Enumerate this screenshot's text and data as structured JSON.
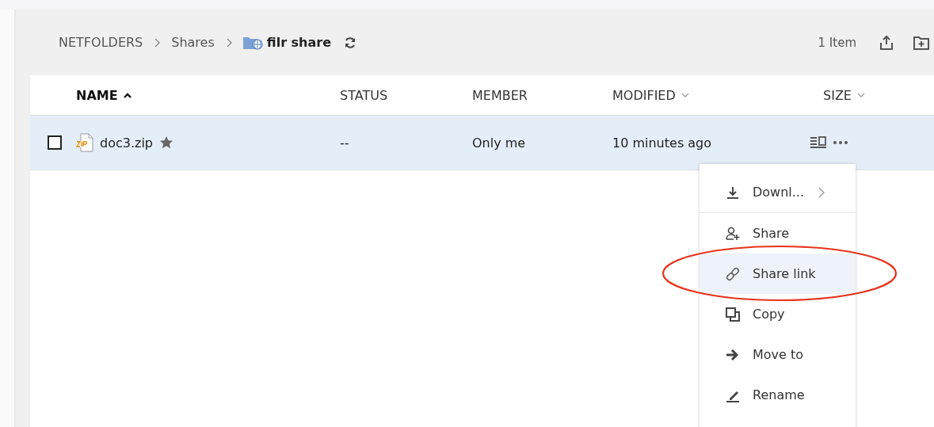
{
  "breadcrumb": [
    {
      "label": "NETFOLDERS",
      "kind": "link"
    },
    {
      "label": "Shares",
      "kind": "link"
    },
    {
      "label": "filr share",
      "kind": "current"
    }
  ],
  "item_count": "1 Item",
  "table": {
    "columns": [
      {
        "label": "NAME",
        "kind": "sorted"
      },
      {
        "label": "STATUS",
        "kind": "plain"
      },
      {
        "label": "MEMBER",
        "kind": "plain"
      },
      {
        "label": "MODIFIED",
        "kind": "sortable"
      },
      {
        "label": "SIZE",
        "kind": "sortable"
      }
    ],
    "rows": [
      {
        "name": "doc3.zip",
        "starred": true,
        "checked": false,
        "selected": true,
        "status": "--",
        "member": "Only me",
        "modified": "10 minutes ago"
      }
    ]
  },
  "context_menu": {
    "items": [
      {
        "label": "Downl...",
        "kind": "download",
        "has_submenu": true,
        "divider_after": true,
        "highlighted": false,
        "circled": false
      },
      {
        "label": "Share",
        "kind": "share",
        "has_submenu": false,
        "divider_after": false,
        "highlighted": false,
        "circled": false
      },
      {
        "label": "Share link",
        "kind": "link",
        "has_submenu": false,
        "divider_after": false,
        "highlighted": true,
        "circled": true
      },
      {
        "label": "Copy",
        "kind": "copy",
        "has_submenu": false,
        "divider_after": false,
        "highlighted": false,
        "circled": false
      },
      {
        "label": "Move to",
        "kind": "move",
        "has_submenu": false,
        "divider_after": false,
        "highlighted": false,
        "circled": false
      },
      {
        "label": "Rename",
        "kind": "rename",
        "has_submenu": false,
        "divider_after": false,
        "highlighted": false,
        "circled": false
      }
    ]
  }
}
